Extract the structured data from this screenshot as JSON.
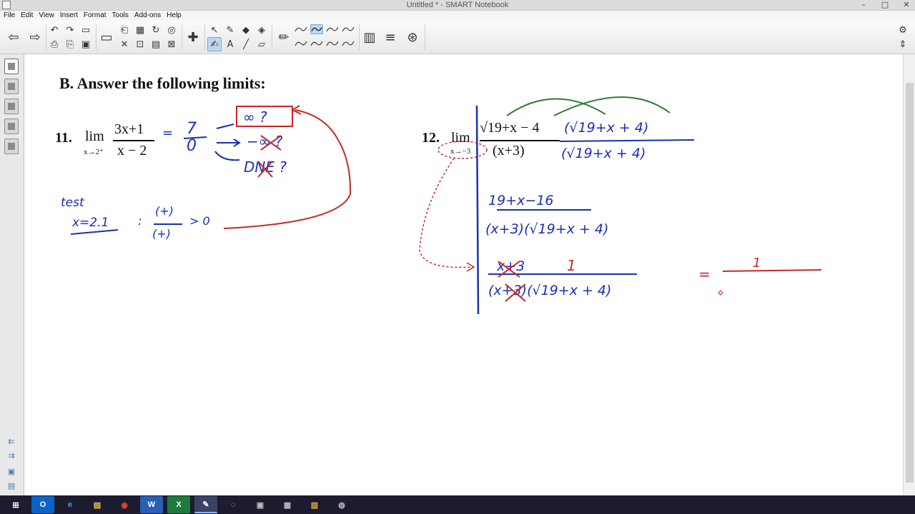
{
  "window": {
    "title": "Untitled * - SMART Notebook"
  },
  "menu": [
    "File",
    "Edit",
    "View",
    "Insert",
    "Format",
    "Tools",
    "Add-ons",
    "Help"
  ],
  "toolbar": {
    "icons": [
      "back-icon",
      "forward-icon",
      "undo-icon",
      "redo-icon",
      "page-icon",
      "screen-shade-icon",
      "table-icon",
      "capture-icon",
      "document-camera-icon",
      "select-icon",
      "magic-pen-icon",
      "eraser-icon",
      "fill-icon",
      "pen-icon",
      "text-icon",
      "line-icon",
      "shapes-icon",
      "color-palette-icon",
      "properties-icon",
      "add-ons-icon",
      "settings-icon"
    ]
  },
  "canvas": {
    "heading": "B. Answer the following limits:",
    "problem11": {
      "number": "11.",
      "lim": "lim",
      "sub": "x→2⁺",
      "numerator": "3x+1",
      "denominator": "x − 2",
      "ink": {
        "equals": "=",
        "seven": "7",
        "zero": "0",
        "arrow1": "→",
        "inf_box": "∞  ?",
        "neg_inf": "−∞ ?",
        "dne": "DNE ?",
        "test": "test",
        "x_val": "x=2.1",
        "plus_num": "(+)",
        "plus_den": "(+)",
        "gt0": "> 0",
        "colon": ":"
      }
    },
    "problem12": {
      "number": "12.",
      "lim": "lim",
      "sub": "x→−3",
      "numerator": "√19+x − 4",
      "denominator": "(x+3)",
      "ink": {
        "conj_num": "(√19+x  + 4)",
        "conj_den": "(√19+x   + 4)",
        "step2_num": "19+x−16",
        "step2_den": "(x+3)(√19+x  + 4)",
        "step3_num": "x+3",
        "one": "1",
        "step3_den": "(x+3)(√19+x  + 4)",
        "equals": "=",
        "result_num": "1"
      }
    }
  },
  "taskbar": {
    "items": [
      "start",
      "outlook",
      "internet-explorer",
      "file-explorer",
      "chrome",
      "word",
      "excel",
      "smart-notebook",
      "app-9",
      "app-10",
      "app-11",
      "app-12",
      "app-13"
    ],
    "labels": [
      "⊞",
      "O",
      "e",
      "▤",
      "◉",
      "W",
      "X",
      "✎",
      "◌",
      "▣",
      "▦",
      "▧",
      "◍"
    ]
  }
}
